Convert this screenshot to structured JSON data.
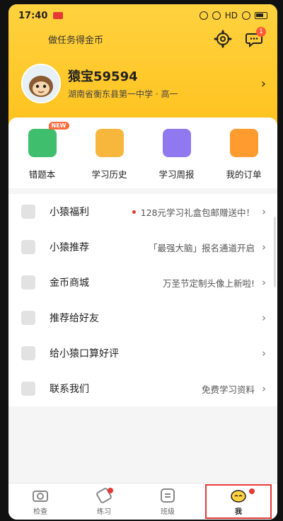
{
  "status_bar": {
    "time": "17:40",
    "network": "HD"
  },
  "top": {
    "task_text": "做任务得金币",
    "message_badge": "1"
  },
  "profile": {
    "username": "猿宝59594",
    "school": "湖南省衡东县第一中学 · 高一"
  },
  "shortcuts": [
    {
      "label": "错题本",
      "badge": "NEW",
      "icon": "wrong-answer-book-icon"
    },
    {
      "label": "学习历史",
      "icon": "study-history-icon"
    },
    {
      "label": "学习周报",
      "icon": "weekly-report-icon"
    },
    {
      "label": "我的订单",
      "icon": "my-orders-icon"
    }
  ],
  "menu": [
    {
      "label": "小猿福利",
      "sub": "128元学习礼盒包邮赠送中！",
      "dot": true,
      "icon": "gift-icon"
    },
    {
      "label": "小猿推荐",
      "sub": "「最强大脑」报名通道开启",
      "icon": "home-icon"
    },
    {
      "label": "金币商城",
      "sub": "万圣节定制头像上新啦!",
      "icon": "mail-icon"
    },
    {
      "label": "推荐给好友",
      "sub": "",
      "icon": "people-icon"
    },
    {
      "label": "给小猿口算好评",
      "sub": "",
      "icon": "thumbs-up-icon"
    },
    {
      "label": "联系我们",
      "sub": "免费学习资料",
      "icon": "chat-icon"
    }
  ],
  "tabs": [
    {
      "label": "检查",
      "icon": "camera-icon"
    },
    {
      "label": "练习",
      "icon": "practice-icon",
      "dot": true
    },
    {
      "label": "班级",
      "icon": "class-icon"
    },
    {
      "label": "我",
      "icon": "me-icon",
      "dot": true,
      "active": true
    }
  ],
  "colors": {
    "header": "#ffc21e",
    "accent": "#ff6b3d",
    "dot": "#e53935"
  }
}
